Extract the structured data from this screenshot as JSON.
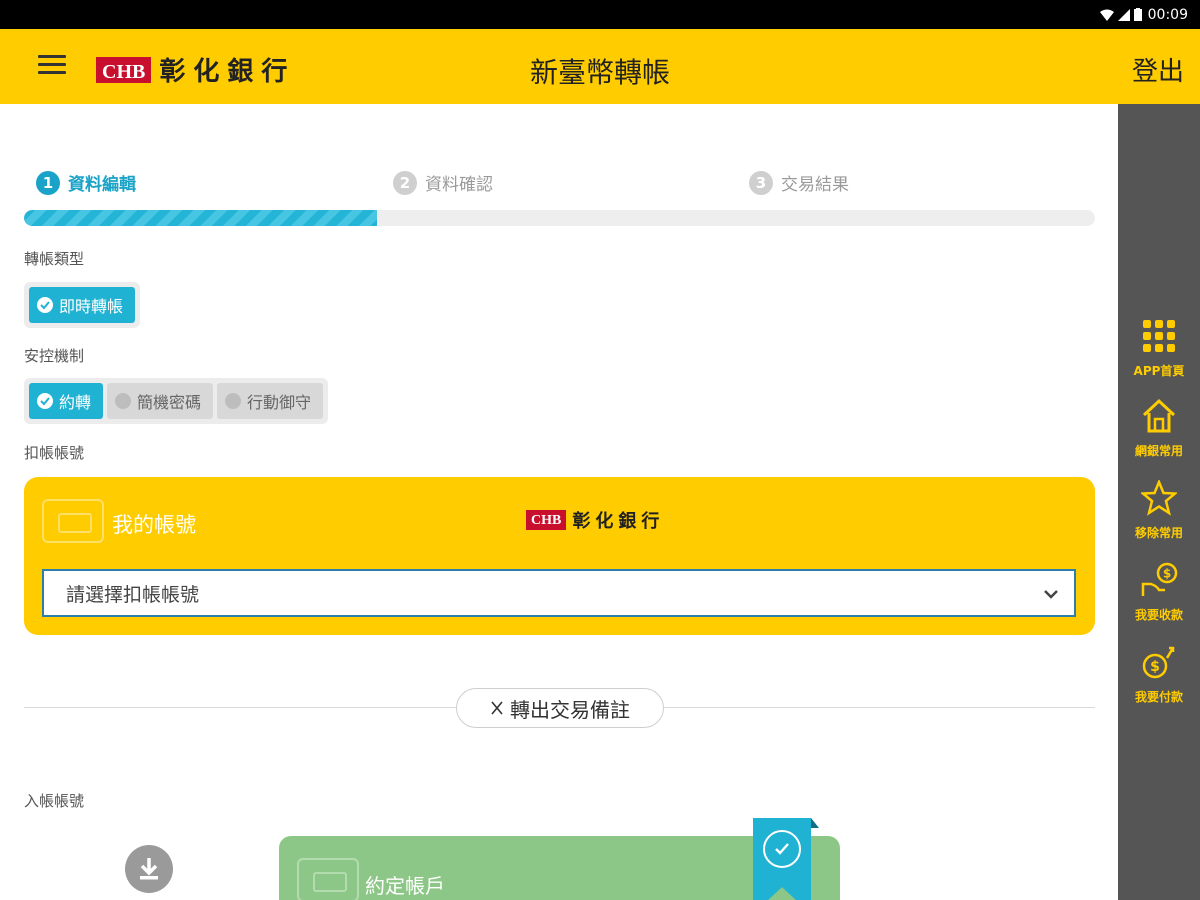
{
  "status_bar": {
    "time": "00:09"
  },
  "app_bar": {
    "logo_mark": "CHB",
    "logo_name": "彰化銀行",
    "title": "新臺幣轉帳",
    "logout_label": "登出"
  },
  "steps": [
    {
      "num": "1",
      "label": "資料編輯",
      "active": true
    },
    {
      "num": "2",
      "label": "資料確認",
      "active": false
    },
    {
      "num": "3",
      "label": "交易結果",
      "active": false
    }
  ],
  "progress_fraction": 0.33,
  "transfer_type": {
    "label": "轉帳類型",
    "options": [
      {
        "label": "即時轉帳",
        "selected": true
      }
    ]
  },
  "security": {
    "label": "安控機制",
    "options": [
      {
        "label": "約轉",
        "selected": true
      },
      {
        "label": "簡機密碼",
        "selected": false
      },
      {
        "label": "行動御守",
        "selected": false
      }
    ]
  },
  "debit": {
    "label": "扣帳帳號",
    "card_title": "我的帳號",
    "card_logo_mark": "CHB",
    "card_logo_name": "彰化銀行",
    "select_placeholder": "請選擇扣帳帳號"
  },
  "memo_button_label": "轉出交易備註",
  "credit": {
    "label": "入帳帳號",
    "card_title": "約定帳戶"
  },
  "side_menu": [
    {
      "label": "APP首頁",
      "icon": "grid-icon"
    },
    {
      "label": "網銀常用",
      "icon": "home-icon"
    },
    {
      "label": "移除常用",
      "icon": "star-icon"
    },
    {
      "label": "我要收款",
      "icon": "receive-money-icon"
    },
    {
      "label": "我要付款",
      "icon": "pay-money-icon"
    }
  ],
  "colors": {
    "brand_yellow": "#ffcc00",
    "accent_cyan": "#1fb2d2",
    "side_panel": "#555555",
    "dest_card_green": "#8dc787",
    "logo_red": "#c8102e"
  }
}
